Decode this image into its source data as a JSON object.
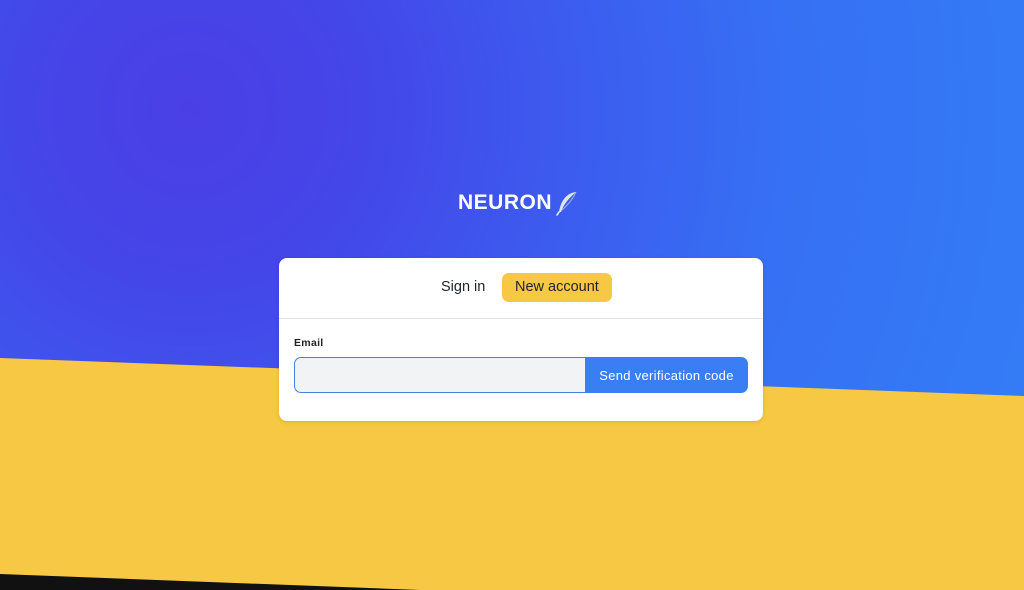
{
  "logo": {
    "text": "NEURON",
    "icon": "feather-icon"
  },
  "tabs": [
    {
      "label": "Sign in",
      "selected": false
    },
    {
      "label": "New account",
      "selected": true
    }
  ],
  "form": {
    "email_label": "Email",
    "email_value": "",
    "email_placeholder": "",
    "send_button_label": "Send verification code"
  },
  "colors": {
    "blue_background": "#337ff7",
    "purple_background": "#4a3fe6",
    "yellow_accent": "#f7c843",
    "primary_button": "#3a7ef3"
  }
}
